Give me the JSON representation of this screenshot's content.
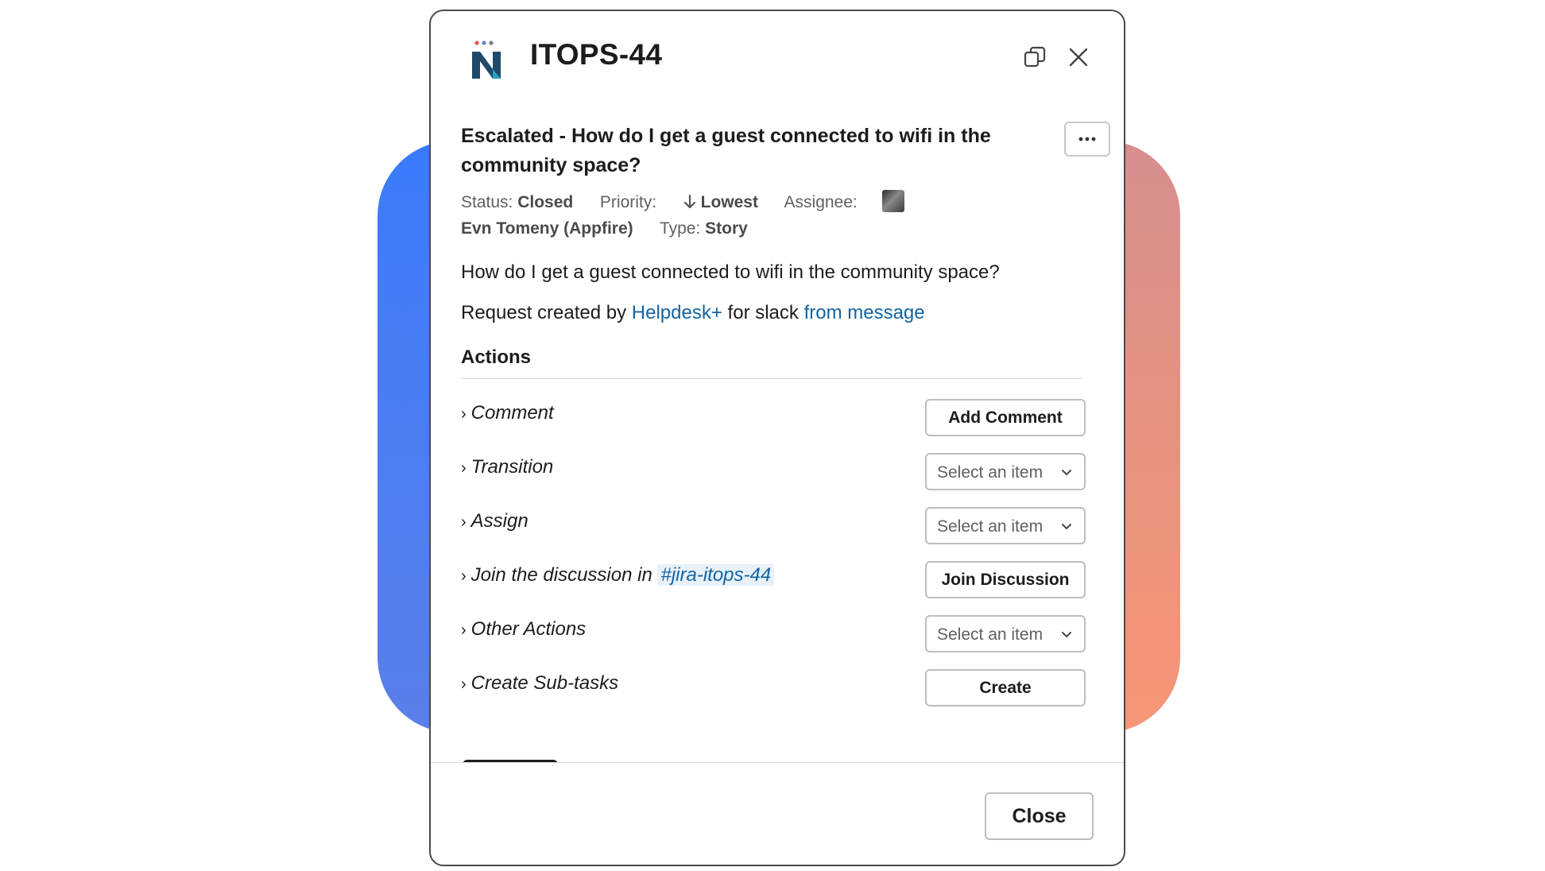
{
  "modal": {
    "title": "ITOPS-44",
    "issue_title": "Escalated - How do I get a guest connected to wifi in the community space?",
    "status_label": "Status:",
    "status_value": "Closed",
    "priority_label": "Priority:",
    "priority_value": "Lowest",
    "assignee_label": "Assignee:",
    "assignee_name": "Evn Tomeny (Appfire)",
    "type_label": "Type:",
    "type_value": "Story",
    "description": "How do I get a guest connected to wifi in the community space?",
    "request_prefix": "Request created by",
    "request_link1": "Helpdesk+",
    "request_middle": "for slack",
    "request_link2": "from message",
    "actions_title": "Actions",
    "actions": {
      "comment": {
        "label": "Comment",
        "button": "Add Comment"
      },
      "transition": {
        "label": "Transition",
        "select_placeholder": "Select an item"
      },
      "assign": {
        "label": "Assign",
        "select_placeholder": "Select an item"
      },
      "join": {
        "label_prefix": "Join the discussion in",
        "channel": "#jira-itops-44",
        "button": "Join Discussion"
      },
      "other": {
        "label": "Other Actions",
        "select_placeholder": "Select an item"
      },
      "subtasks": {
        "label": "Create Sub-tasks",
        "button": "Create"
      }
    },
    "close_button": "Close"
  },
  "icons": {
    "logo": "n-logo-icon",
    "copy": "copy-icon",
    "close": "close-icon",
    "more": "more-icon",
    "priority": "arrow-down-icon",
    "chevron": "chevron-right-icon",
    "caret": "chevron-down-icon"
  },
  "colors": {
    "link": "#1264a3",
    "logo_navy": "#1f4a6b",
    "bg_left": "#3a7bfd",
    "bg_right": "#f79677"
  }
}
